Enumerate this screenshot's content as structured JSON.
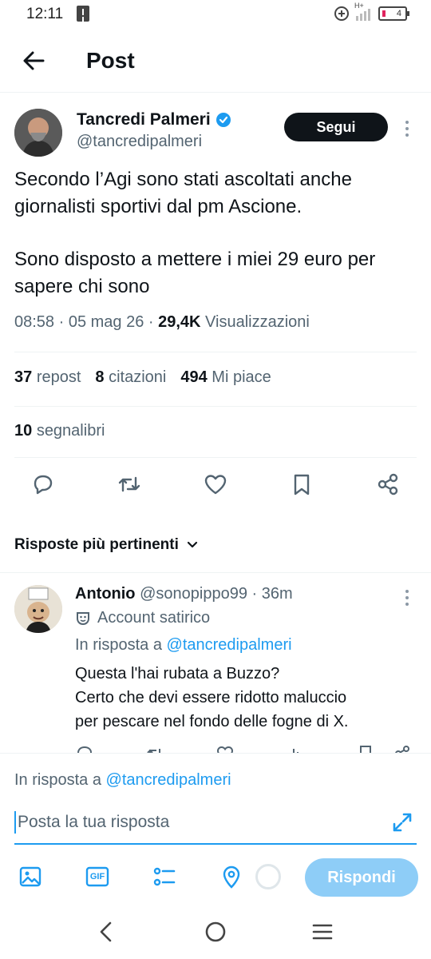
{
  "status": {
    "time": "12:11",
    "network": "H+",
    "battery": "4"
  },
  "header": {
    "title": "Post"
  },
  "tweet": {
    "author_name": "Tancredi Palmeri",
    "handle": "@tancredipalmeri",
    "follow_label": "Segui",
    "text_p1": "Secondo l’Agi sono stati ascoltati anche giornalisti sportivi dal pm Ascione.",
    "text_p2": "Sono disposto a mettere i miei 29 euro per sapere chi sono",
    "timestamp": "08:58 · 05 mag 26 · ",
    "views_count": "29,4K",
    "views_label": " Visualizzazioni",
    "reposts_count": "37",
    "reposts_label": "repost",
    "quotes_count": "8",
    "quotes_label": "citazioni",
    "likes_count": "494",
    "likes_label": "Mi piace",
    "bookmarks_count": "10",
    "bookmarks_label": "segnalibri"
  },
  "replies_sort": {
    "label": "Risposte più pertinenti"
  },
  "reply": {
    "name": "Antonio",
    "handle": "@sonopippo99",
    "time": " · 36m",
    "label": "Account satirico",
    "in_reply_prefix": "In risposta a ",
    "in_reply_handle": "@tancredipalmeri",
    "line1": "Questa l'hai rubata a Buzzo?",
    "line2": "Certo che devi essere ridotto maluccio",
    "line3": "per pescare nel fondo delle fogne di X."
  },
  "compose": {
    "in_reply_prefix": "In risposta a ",
    "in_reply_handle": "@tancredipalmeri",
    "placeholder": "Posta la tua risposta",
    "gif_label": "GIF",
    "reply_button": "Rispondi"
  },
  "colors": {
    "accent": "#1d9bf0",
    "text": "#0f1419",
    "muted": "#536471",
    "reply_button_disabled": "#8ecdf7"
  }
}
